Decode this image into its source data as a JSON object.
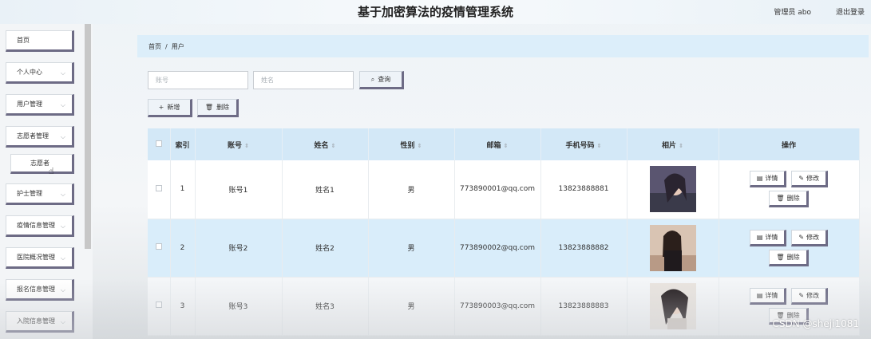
{
  "header": {
    "title": "基于加密算法的疫情管理系统",
    "user": "管理员 abo",
    "logout": "退出登录"
  },
  "sidebar": {
    "items": [
      {
        "label": "首页",
        "chevron": false
      },
      {
        "label": "个人中心",
        "chevron": true
      },
      {
        "label": "用户管理",
        "chevron": true
      },
      {
        "label": "志愿者管理",
        "chevron": true
      },
      {
        "label": "护士管理",
        "chevron": true
      },
      {
        "label": "疫情信息管理",
        "chevron": true
      },
      {
        "label": "医院概况管理",
        "chevron": true
      },
      {
        "label": "报名信息管理",
        "chevron": true
      },
      {
        "label": "入院信息管理",
        "chevron": true
      }
    ],
    "submenu": "志愿者"
  },
  "breadcrumb": {
    "home": "首页",
    "sep": "/",
    "current": "用户"
  },
  "search": {
    "account_placeholder": "账号",
    "name_placeholder": "姓名",
    "query_label": "查询"
  },
  "actions": {
    "add_label": "新增",
    "delete_label": "删除"
  },
  "table": {
    "headers": {
      "index": "索引",
      "account": "账号",
      "name": "姓名",
      "gender": "性别",
      "email": "邮箱",
      "phone": "手机号码",
      "photo": "相片",
      "ops": "操作"
    },
    "rows": [
      {
        "index": "1",
        "account": "账号1",
        "name": "姓名1",
        "gender": "男",
        "email": "773890001@qq.com",
        "phone": "13823888881"
      },
      {
        "index": "2",
        "account": "账号2",
        "name": "姓名2",
        "gender": "男",
        "email": "773890002@qq.com",
        "phone": "13823888882"
      },
      {
        "index": "3",
        "account": "账号3",
        "name": "姓名3",
        "gender": "男",
        "email": "773890003@qq.com",
        "phone": "13823888883"
      }
    ],
    "op_labels": {
      "detail": "详情",
      "edit": "修改",
      "delete": "删除"
    }
  },
  "watermark": "CSDN @sheji1081",
  "colors": {
    "accent": "#6d6b85",
    "header_bg": "#d3e8f7",
    "breadcrumb_bg": "#dceefa"
  }
}
